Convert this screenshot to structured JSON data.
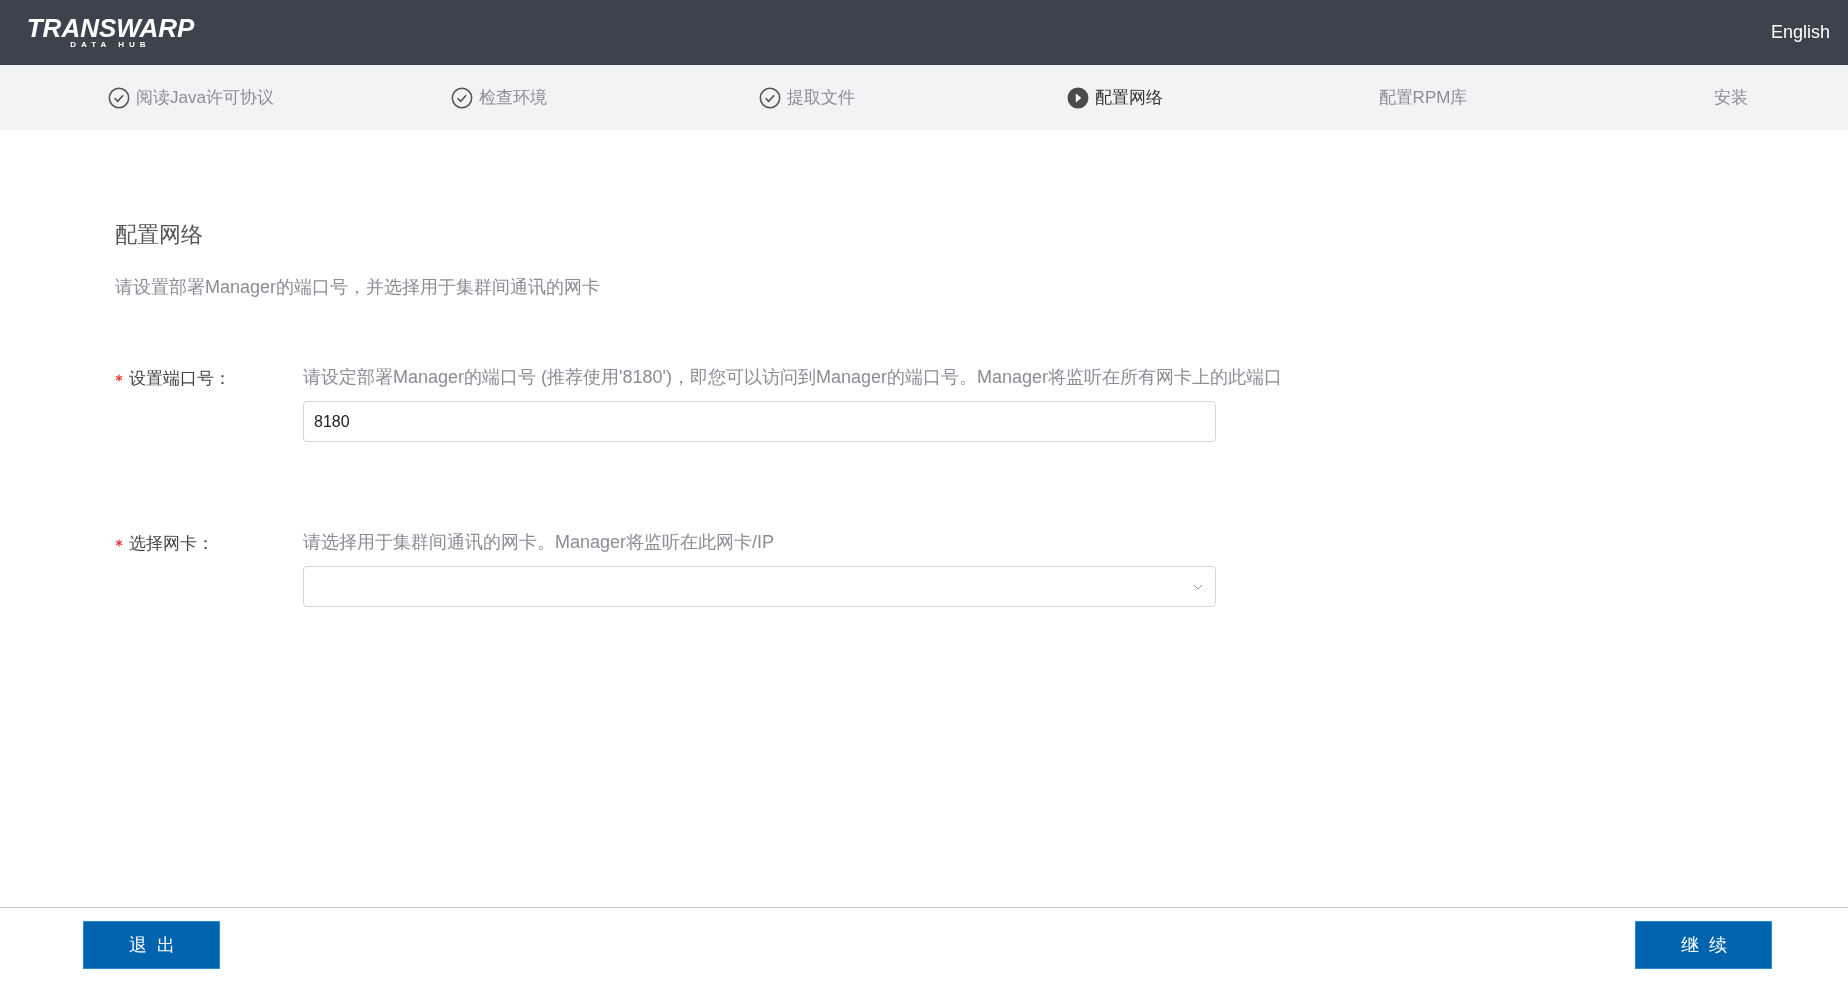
{
  "header": {
    "logo": {
      "name": "TRANSWARP",
      "sub": "DATA HUB"
    },
    "language": "English"
  },
  "steps": [
    {
      "label": "阅读Java许可协议",
      "kind": "done"
    },
    {
      "label": "检查环境",
      "kind": "done"
    },
    {
      "label": "提取文件",
      "kind": "done"
    },
    {
      "label": "配置网络",
      "kind": "current"
    },
    {
      "label": "配置RPM库",
      "kind": "pending"
    },
    {
      "label": "安装",
      "kind": "pending"
    }
  ],
  "section": {
    "title": "配置网络",
    "description": "请设置部署Manager的端口号，并选择用于集群间通讯的网卡"
  },
  "fields": [
    {
      "label": "设置端口号：",
      "required": true,
      "hint": "请设定部署Manager的端口号 (推荐使用'8180')，即您可以访问到Manager的端口号。Manager将监听在所有网卡上的此端口",
      "kind": "text",
      "value": "8180"
    },
    {
      "label": "选择网卡：",
      "required": true,
      "hint": "请选择用于集群间通讯的网卡。Manager将监听在此网卡/IP",
      "kind": "select"
    }
  ],
  "footer": {
    "buttons": [
      "退出",
      "继续"
    ]
  }
}
